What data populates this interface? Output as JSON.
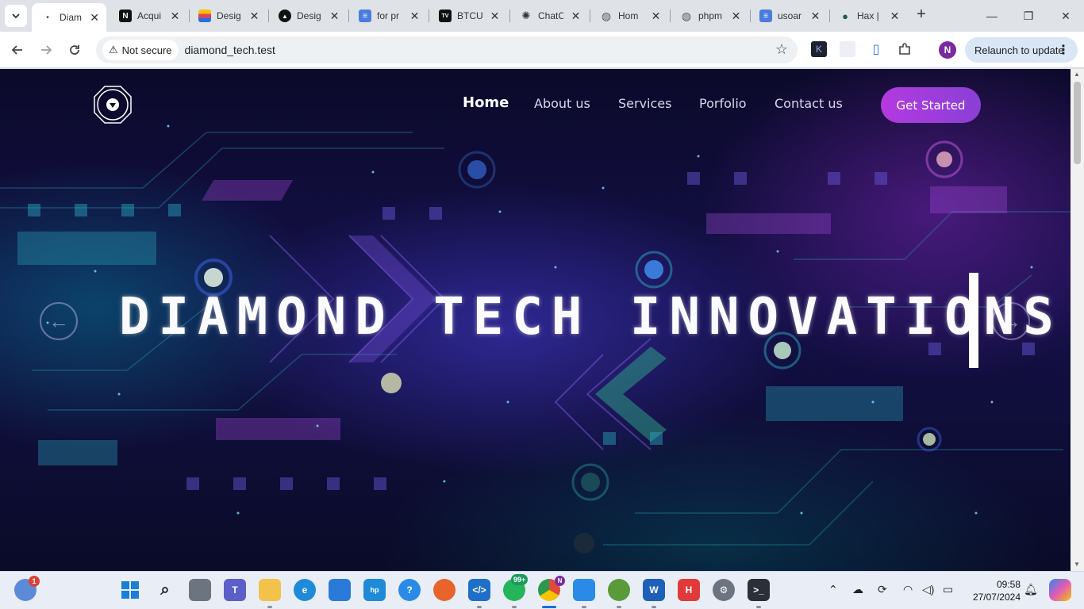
{
  "browser": {
    "tabs": [
      {
        "title": "Diam",
        "favicon_bg": "#ffffff",
        "favicon_glyph": "•",
        "active": true
      },
      {
        "title": "Acqui",
        "favicon_bg": "#111111",
        "favicon_glyph": "N",
        "active": false
      },
      {
        "title": "Desig",
        "favicon_bg": "#e44d7a",
        "favicon_glyph": "",
        "active": false
      },
      {
        "title": "Desig",
        "favicon_bg": "#111111",
        "favicon_glyph": "▲",
        "active": false
      },
      {
        "title": "for pr",
        "favicon_bg": "#4a7ddc",
        "favicon_glyph": "≡",
        "active": false
      },
      {
        "title": "BTCU",
        "favicon_bg": "#111111",
        "favicon_glyph": "TV",
        "active": false
      },
      {
        "title": "ChatC",
        "favicon_bg": "#ffffff",
        "favicon_glyph": "✺",
        "active": false
      },
      {
        "title": "Hom",
        "favicon_bg": "#ffffff",
        "favicon_glyph": "◍",
        "active": false
      },
      {
        "title": "phpm",
        "favicon_bg": "#ffffff",
        "favicon_glyph": "◍",
        "active": false
      },
      {
        "title": "usoar",
        "favicon_bg": "#4a7ddc",
        "favicon_glyph": "≡",
        "active": false
      },
      {
        "title": "Hax |",
        "favicon_bg": "#1f5f4a",
        "favicon_glyph": "●",
        "active": false
      }
    ],
    "tab_close_glyph": "✕",
    "new_tab_glyph": "+",
    "window": {
      "minimize": "—",
      "restore": "❐",
      "close": "✕"
    },
    "security_label": "Not secure",
    "url": "diamond_tech.test",
    "profile_initial": "N",
    "relaunch_label": "Relaunch to update"
  },
  "site": {
    "nav": [
      {
        "label": "Home",
        "active": true
      },
      {
        "label": "About us",
        "active": false
      },
      {
        "label": "Services",
        "active": false
      },
      {
        "label": "Porfolio",
        "active": false
      },
      {
        "label": "Contact us",
        "active": false
      }
    ],
    "cta_label": "Get Started",
    "hero_title": "DIAMOND TECH INNOVATIONS",
    "prev_glyph": "←",
    "next_glyph": "→"
  },
  "taskbar": {
    "weather_badge": "1",
    "whatsapp_badge": "99+",
    "chrome_badge": "N",
    "time": "09:58",
    "date": "27/07/2024"
  },
  "colors": {
    "accent_purple": "#b33ae0",
    "hero_bg": "#141048",
    "chrome_tabstrip": "#dfe3e8"
  }
}
